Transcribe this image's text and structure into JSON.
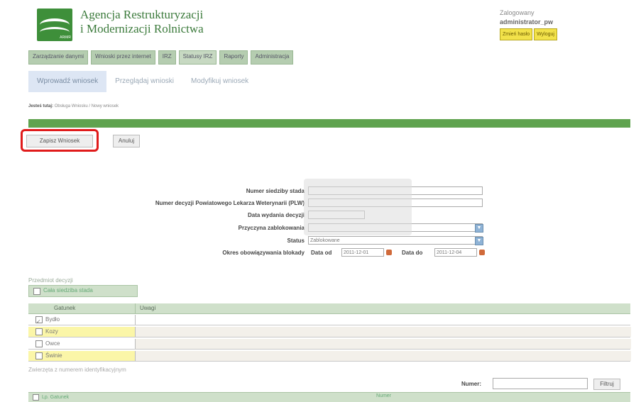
{
  "header": {
    "org_line1": "Agencja Restrukturyzacji",
    "org_line2": "i Modernizacji Rolnictwa",
    "logo_text": "ARiMR",
    "logged_label": "Zalogowany",
    "user_name": "administrator_pw",
    "btn_change": "Zmień hasło",
    "btn_logout": "Wyloguj"
  },
  "nav": {
    "items": [
      "Zarządzanie danymi",
      "Wnioski przez internet",
      "IRZ",
      "Statusy IRZ",
      "Raporty",
      "Administracja"
    ],
    "active_index": 3
  },
  "subnav": {
    "items": [
      "Wprowadź wniosek",
      "Przeglądaj wnioski",
      "Modyfikuj wniosek"
    ],
    "active_index": 0
  },
  "breadcrumb": {
    "bold": "Jesteś tutaj:",
    "rest": "Obsługa Wniosku / Nowy wniosek"
  },
  "actions": {
    "save": "Zapisz Wniosek",
    "cancel": "Anuluj"
  },
  "form": {
    "f1_label": "Numer siedziby stada",
    "f1_value": "",
    "f2_label": "Numer decyzji Powiatowego Lekarza Weterynarii (PLW)",
    "f2_value": "",
    "f3_label": "Data wydania decyzji",
    "f3_value": "",
    "f4_label": "Przyczyna zablokowania",
    "f4_value": "",
    "f5_label": "Status",
    "f5_value": "Zablokowane",
    "f6_label": "Okres obowiązywania blokady",
    "date_from_label": "Data od",
    "date_from": "2011-12-01",
    "date_to_label": "Data do",
    "date_to": "2011-12-04"
  },
  "decision": {
    "section_label": "Przedmiot decyzji",
    "whole_herd_label": "Cała siedziba stada",
    "col_species": "Gatunek",
    "col_values": "Uwagi",
    "rows": [
      {
        "name": "Bydło",
        "checked": true,
        "color": "#ffffff"
      },
      {
        "name": "Kozy",
        "checked": false,
        "color": "#fbf6a8"
      },
      {
        "name": "Owce",
        "checked": false,
        "color": "#ffffff"
      },
      {
        "name": "Świnie",
        "checked": false,
        "color": "#fbf6a8"
      }
    ]
  },
  "footer": {
    "note": "Zwierzęta z numerem identyfikacyjnym",
    "number_label": "Numer:",
    "filter_btn": "Filtruj",
    "col1": "Lp. Gatunek",
    "col2": "Numer"
  },
  "colors": {
    "accent_green": "#5fa34f",
    "highlight_red": "#e01b1b",
    "yellow_row": "#fbf6a8"
  }
}
